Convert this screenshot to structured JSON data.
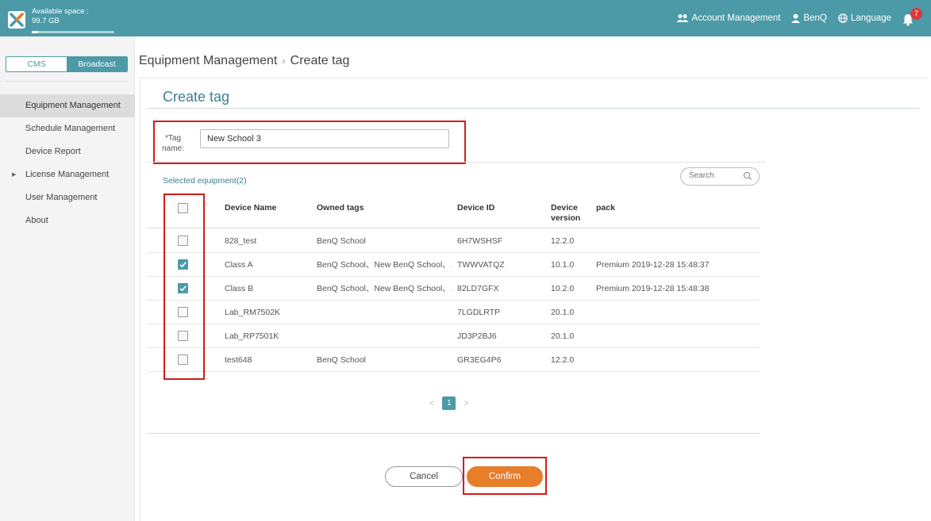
{
  "topbar": {
    "space_label": "Available space : 99.7 GB",
    "space_used_fraction": 0.08,
    "account_management": "Account Management",
    "user": "BenQ",
    "language": "Language",
    "notification_count": "7",
    "accent_color": "#4c9aa7"
  },
  "sidebar": {
    "seg_cms": "CMS",
    "seg_broadcast": "Broadcast",
    "items": [
      {
        "label": "Equipment Management"
      },
      {
        "label": "Schedule Management"
      },
      {
        "label": "Device Report"
      },
      {
        "label": "License Management"
      },
      {
        "label": "User Management"
      },
      {
        "label": "About"
      }
    ]
  },
  "breadcrumb": {
    "parent": "Equipment Management",
    "separator": "›",
    "current": "Create tag"
  },
  "form": {
    "title": "Create tag",
    "tag_label": "*Tag name:",
    "tag_value": "New School 3",
    "selected_label": "Selected equipment(2)",
    "search_placeholder": "Search"
  },
  "table": {
    "headers": {
      "device_name": "Device Name",
      "owned_tags": "Owned tags",
      "device_id": "Device ID",
      "device_version": "Device version",
      "pack": "pack"
    },
    "rows": [
      {
        "checked": false,
        "name": "828_test",
        "tags": "BenQ School",
        "id": "6H7WSHSF",
        "version": "12.2.0",
        "pack": ""
      },
      {
        "checked": true,
        "name": "Class A",
        "tags": "BenQ School、New BenQ School、...",
        "id": "TWWVATQZ",
        "version": "10.1.0",
        "pack": "Premium   2019-12-28 15:48:37"
      },
      {
        "checked": true,
        "name": "Class B",
        "tags": "BenQ School、New BenQ School、...",
        "id": "82LD7GFX",
        "version": "10.2.0",
        "pack": "Premium   2019-12-28 15:48:38"
      },
      {
        "checked": false,
        "name": "Lab_RM7502K",
        "tags": "",
        "id": "7LGDLRTP",
        "version": "20.1.0",
        "pack": ""
      },
      {
        "checked": false,
        "name": "Lab_RP7501K",
        "tags": "",
        "id": "JD3P2BJ6",
        "version": "20.1.0",
        "pack": ""
      },
      {
        "checked": false,
        "name": "test648",
        "tags": "BenQ School",
        "id": "GR3EG4P6",
        "version": "12.2.0",
        "pack": ""
      }
    ]
  },
  "pagination": {
    "prev": "<",
    "page": "1",
    "next": ">"
  },
  "actions": {
    "cancel": "Cancel",
    "confirm": "Confirm",
    "confirm_color": "#e77e2a"
  }
}
